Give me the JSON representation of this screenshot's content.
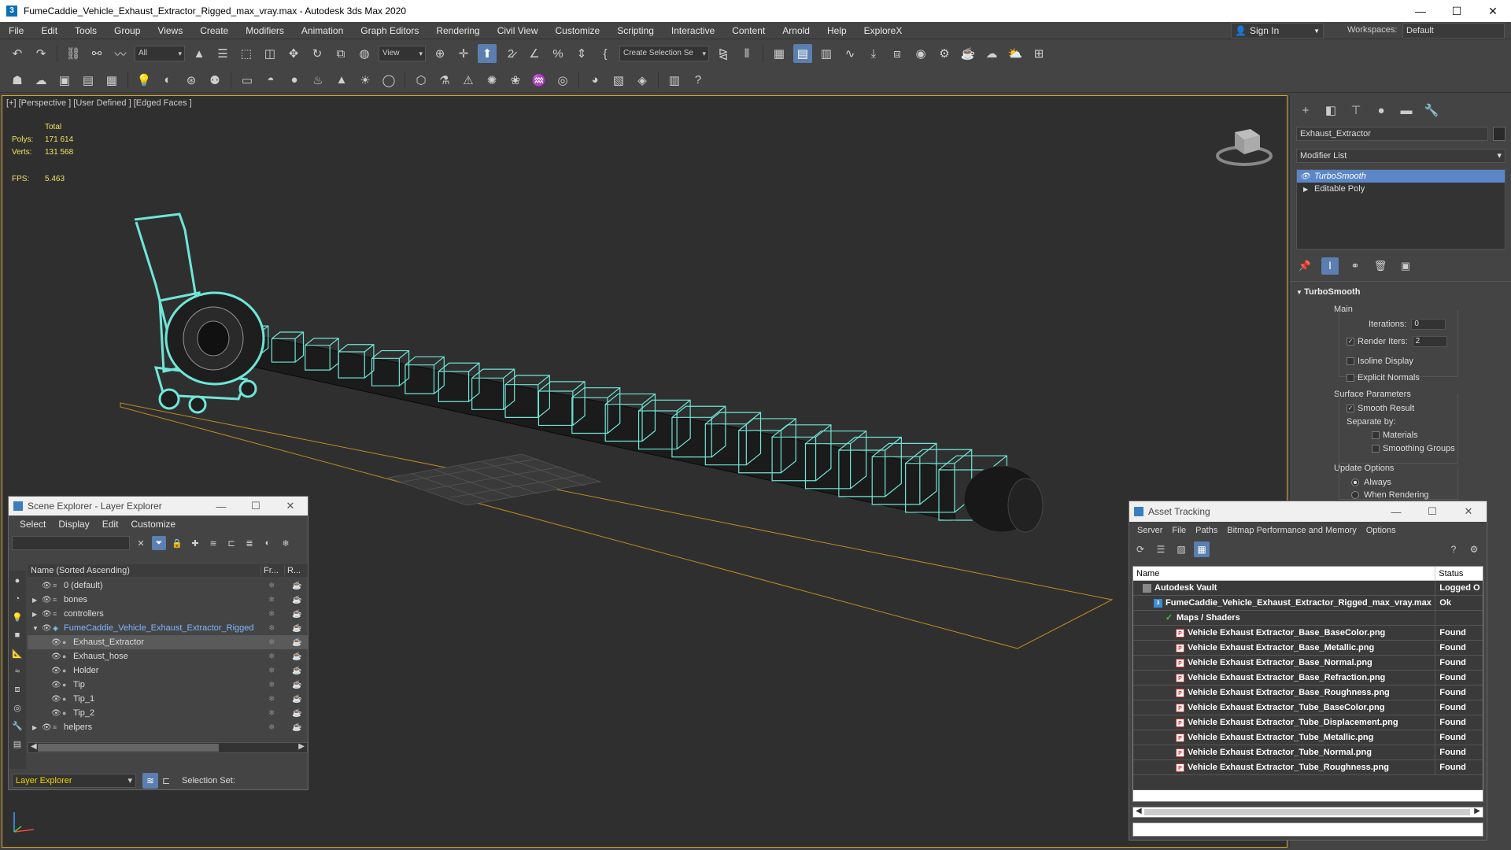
{
  "window": {
    "title": "FumeCaddie_Vehicle_Exhaust_Extractor_Rigged_max_vray.max - Autodesk 3ds Max 2020",
    "app_icon": "3"
  },
  "menu": {
    "items": [
      "File",
      "Edit",
      "Tools",
      "Group",
      "Views",
      "Create",
      "Modifiers",
      "Animation",
      "Graph Editors",
      "Rendering",
      "Civil View",
      "Customize",
      "Scripting",
      "Interactive",
      "Content",
      "Arnold",
      "Help",
      "ExploreX"
    ],
    "sign_in": "Sign In",
    "workspaces_label": "Workspaces:",
    "workspace": "Default"
  },
  "toolbar": {
    "filter": "All",
    "reference_coord": "View",
    "selection_set": "Create Selection Se"
  },
  "viewport": {
    "label": "[+] [Perspective ] [User Defined ] [Edged Faces ]",
    "stats_header": "Total",
    "polys_label": "Polys:",
    "polys": "171 614",
    "verts_label": "Verts:",
    "verts": "131 568",
    "fps_label": "FPS:",
    "fps": "5.463",
    "accent_color": "#d4a62a",
    "wire_color": "#6fe6d8"
  },
  "command_panel": {
    "object_name": "Exhaust_Extractor",
    "modifier_list": "Modifier List",
    "stack": [
      {
        "label": "TurboSmooth",
        "selected": true
      },
      {
        "label": "Editable Poly",
        "selected": false
      }
    ],
    "rollout": "TurboSmooth",
    "main_title": "Main",
    "iterations_label": "Iterations:",
    "iterations": "0",
    "render_iters_label": "Render Iters:",
    "render_iters": "2",
    "isoline": "Isoline Display",
    "explicit_normals": "Explicit Normals",
    "surface_title": "Surface Parameters",
    "smooth_result": "Smooth Result",
    "separate_by": "Separate by:",
    "materials": "Materials",
    "smoothing_groups": "Smoothing Groups",
    "update_title": "Update Options",
    "always": "Always",
    "when_rendering": "When Rendering"
  },
  "scene_explorer": {
    "title": "Scene Explorer - Layer Explorer",
    "menu": [
      "Select",
      "Display",
      "Edit",
      "Customize"
    ],
    "col_name": "Name (Sorted Ascending)",
    "col_freeze": "Fr...",
    "col_render": "R...",
    "rows": [
      {
        "label": "0 (default)",
        "level": 0,
        "exp": "",
        "type": "layer"
      },
      {
        "label": "bones",
        "level": 0,
        "exp": "▶",
        "type": "layer"
      },
      {
        "label": "controllers",
        "level": 0,
        "exp": "▶",
        "type": "layer"
      },
      {
        "label": "FumeCaddie_Vehicle_Exhaust_Extractor_Rigged",
        "level": 0,
        "exp": "▼",
        "type": "active"
      },
      {
        "label": "Exhaust_Extractor",
        "level": 1,
        "exp": "",
        "type": "obj-sel"
      },
      {
        "label": "Exhaust_hose",
        "level": 1,
        "exp": "",
        "type": "obj"
      },
      {
        "label": "Holder",
        "level": 1,
        "exp": "",
        "type": "obj"
      },
      {
        "label": "Tip",
        "level": 1,
        "exp": "",
        "type": "obj"
      },
      {
        "label": "Tip_1",
        "level": 1,
        "exp": "",
        "type": "obj"
      },
      {
        "label": "Tip_2",
        "level": 1,
        "exp": "",
        "type": "obj"
      },
      {
        "label": "helpers",
        "level": 0,
        "exp": "▶",
        "type": "layer"
      }
    ],
    "layer_dropdown": "Layer Explorer",
    "selection_set_label": "Selection Set:"
  },
  "asset_tracking": {
    "title": "Asset Tracking",
    "menu": [
      "Server",
      "File",
      "Paths",
      "Bitmap Performance and Memory",
      "Options"
    ],
    "col_name": "Name",
    "col_status": "Status",
    "rows": [
      {
        "name": "Autodesk Vault",
        "status": "Logged O",
        "indent": 1,
        "icon": "vault"
      },
      {
        "name": "FumeCaddie_Vehicle_Exhaust_Extractor_Rigged_max_vray.max",
        "status": "Ok",
        "indent": 2,
        "icon": "file"
      },
      {
        "name": "Maps / Shaders",
        "status": "",
        "indent": 3,
        "icon": "maps"
      },
      {
        "name": "Vehicle Exhaust Extractor_Base_BaseColor.png",
        "status": "Found",
        "indent": 4,
        "icon": "png"
      },
      {
        "name": "Vehicle Exhaust Extractor_Base_Metallic.png",
        "status": "Found",
        "indent": 4,
        "icon": "png"
      },
      {
        "name": "Vehicle Exhaust Extractor_Base_Normal.png",
        "status": "Found",
        "indent": 4,
        "icon": "png"
      },
      {
        "name": "Vehicle Exhaust Extractor_Base_Refraction.png",
        "status": "Found",
        "indent": 4,
        "icon": "png"
      },
      {
        "name": "Vehicle Exhaust Extractor_Base_Roughness.png",
        "status": "Found",
        "indent": 4,
        "icon": "png"
      },
      {
        "name": "Vehicle Exhaust Extractor_Tube_BaseColor.png",
        "status": "Found",
        "indent": 4,
        "icon": "png"
      },
      {
        "name": "Vehicle Exhaust Extractor_Tube_Displacement.png",
        "status": "Found",
        "indent": 4,
        "icon": "png"
      },
      {
        "name": "Vehicle Exhaust Extractor_Tube_Metallic.png",
        "status": "Found",
        "indent": 4,
        "icon": "png"
      },
      {
        "name": "Vehicle Exhaust Extractor_Tube_Normal.png",
        "status": "Found",
        "indent": 4,
        "icon": "png"
      },
      {
        "name": "Vehicle Exhaust Extractor_Tube_Roughness.png",
        "status": "Found",
        "indent": 4,
        "icon": "png"
      }
    ]
  }
}
